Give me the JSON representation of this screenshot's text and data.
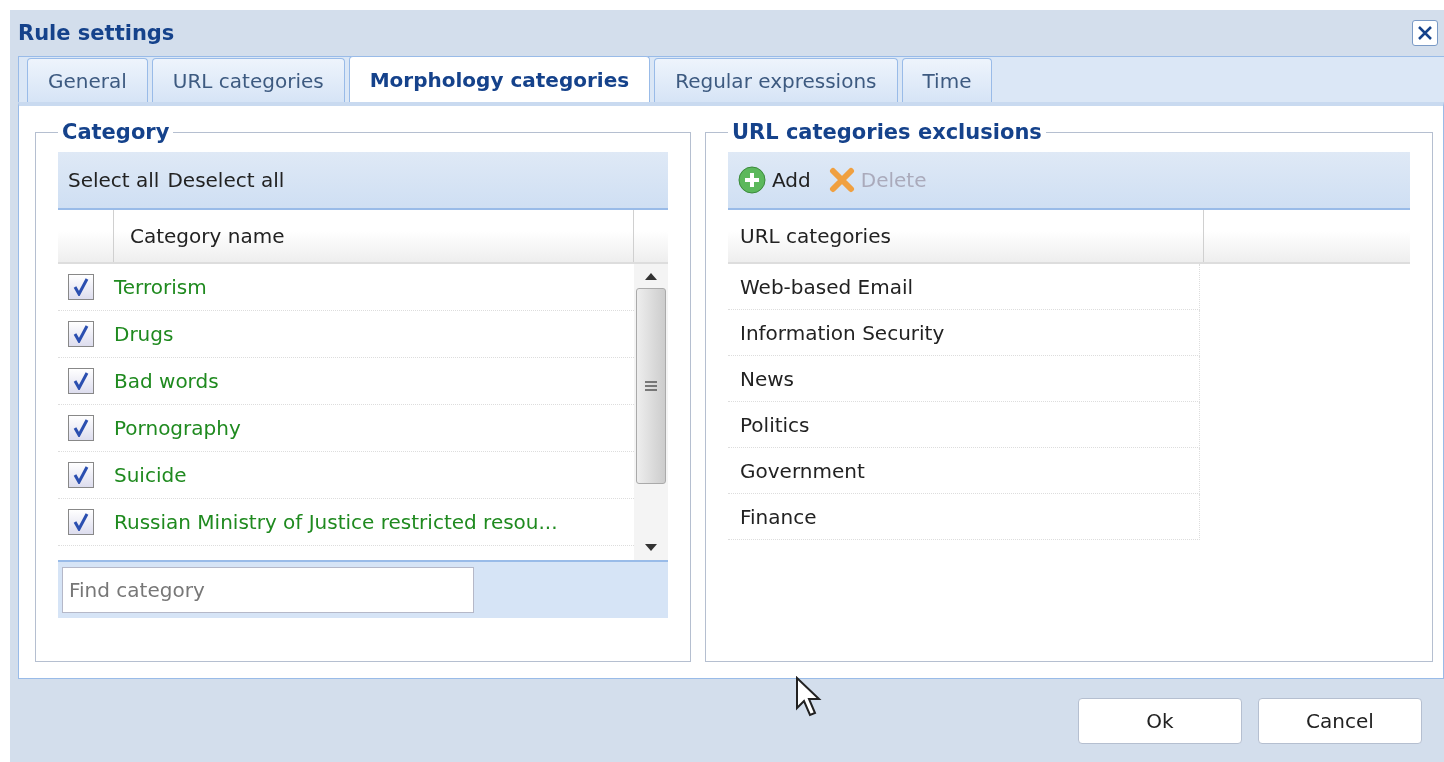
{
  "window": {
    "title": "Rule settings"
  },
  "tabs": [
    {
      "label": "General",
      "selected": false
    },
    {
      "label": "URL categories",
      "selected": false
    },
    {
      "label": "Morphology categories",
      "selected": true
    },
    {
      "label": "Regular expressions",
      "selected": false
    },
    {
      "label": "Time",
      "selected": false
    }
  ],
  "category_panel": {
    "title": "Category",
    "toolbar": [
      "Select all",
      "Deselect all"
    ],
    "column": "Category name",
    "rows": [
      {
        "name": "Terrorism",
        "checked": true
      },
      {
        "name": "Drugs",
        "checked": true
      },
      {
        "name": "Bad words",
        "checked": true
      },
      {
        "name": "Pornography",
        "checked": true
      },
      {
        "name": "Suicide",
        "checked": true
      },
      {
        "name": "Russian Ministry of Justice restricted resou...",
        "checked": true
      }
    ],
    "search": {
      "placeholder": "Find category"
    }
  },
  "exclusions_panel": {
    "title": "URL categories exclusions",
    "toolbar": [
      {
        "label": "Add",
        "kind": "add",
        "disabled": false
      },
      {
        "label": "Delete",
        "kind": "delete",
        "disabled": true
      }
    ],
    "column": "URL categories",
    "rows": [
      "Web-based Email",
      "Information Security",
      "News",
      "Politics",
      "Government",
      "Finance"
    ]
  },
  "buttons": [
    "Ok",
    "Cancel"
  ]
}
